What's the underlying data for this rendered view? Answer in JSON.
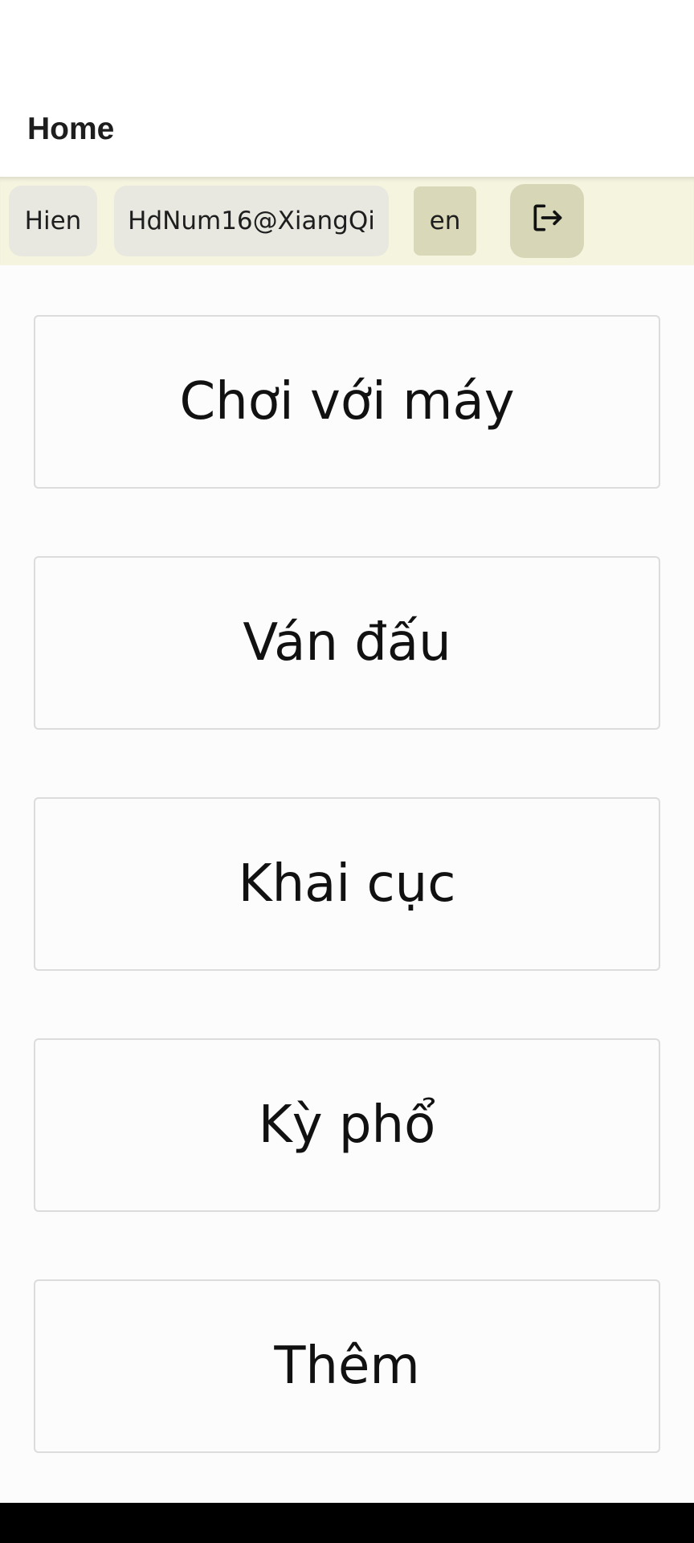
{
  "header": {
    "title": "Home"
  },
  "toolbar": {
    "user_name": "Hien",
    "user_email": "HdNum16@XiangQi",
    "language": "en",
    "logout_icon": "logout-icon"
  },
  "menu": [
    {
      "label": "Chơi với máy"
    },
    {
      "label": "Ván đấu"
    },
    {
      "label": "Khai cục"
    },
    {
      "label": "Kỳ phổ"
    },
    {
      "label": "Thêm"
    }
  ],
  "colors": {
    "toolbar_bg": "#f4f4df",
    "chip_bg": "#e8e8e1",
    "accent_chip_bg": "#d7d6b7",
    "system_nav_bg": "#000000"
  }
}
